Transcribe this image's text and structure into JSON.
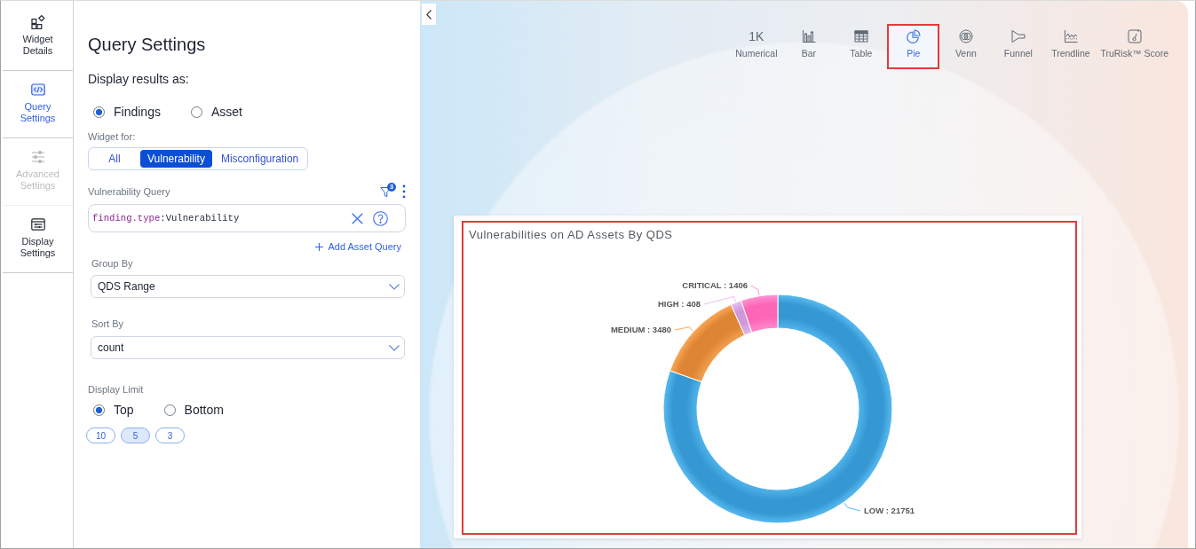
{
  "sidebar": {
    "items": [
      {
        "label": "Widget Details",
        "selected": false,
        "disabled": false
      },
      {
        "label": "Query Settings",
        "selected": true,
        "disabled": false
      },
      {
        "label": "Advanced Settings",
        "selected": false,
        "disabled": true
      },
      {
        "label": "Display Settings",
        "selected": false,
        "disabled": false
      }
    ]
  },
  "query_settings": {
    "title": "Query Settings",
    "display_results": {
      "label": "Display results as:",
      "options": [
        {
          "label": "Findings",
          "selected": true
        },
        {
          "label": "Asset",
          "selected": false
        }
      ]
    },
    "widget_for": {
      "label": "Widget for:",
      "tabs": [
        {
          "label": "All",
          "selected": false
        },
        {
          "label": "Vulnerability",
          "selected": true
        },
        {
          "label": "Misconfiguration",
          "selected": false
        }
      ]
    },
    "query": {
      "label": "Vulnerability Query",
      "filter_badge": "3",
      "tokens": [
        {
          "kind": "key",
          "text": "finding.type"
        },
        {
          "kind": "operator",
          "text": ":"
        },
        {
          "kind": "value",
          "text": "Vulnerability"
        }
      ],
      "add_link": "Add Asset Query"
    },
    "group_by": {
      "label": "Group By",
      "value": "QDS Range"
    },
    "sort_by": {
      "label": "Sort By",
      "value": "count"
    },
    "display_limit": {
      "label": "Display Limit",
      "options": [
        {
          "label": "Top",
          "selected": true
        },
        {
          "label": "Bottom",
          "selected": false
        }
      ],
      "chips": [
        {
          "label": "10",
          "selected": false
        },
        {
          "label": "5",
          "selected": true
        },
        {
          "label": "3",
          "selected": false
        }
      ]
    }
  },
  "preview": {
    "chart_types": [
      {
        "label": "Numerical",
        "glyph": "1K",
        "selected": false,
        "highlighted": false
      },
      {
        "label": "Bar",
        "selected": false,
        "highlighted": false
      },
      {
        "label": "Table",
        "selected": false,
        "highlighted": false
      },
      {
        "label": "Pie",
        "selected": true,
        "highlighted": true
      },
      {
        "label": "Venn",
        "selected": false,
        "highlighted": false
      },
      {
        "label": "Funnel",
        "selected": false,
        "highlighted": false
      },
      {
        "label": "Trendline",
        "selected": false,
        "highlighted": false
      },
      {
        "label": "TruRisk™ Score",
        "selected": false,
        "highlighted": false
      }
    ],
    "widget": {
      "highlighted": true,
      "chart_data": {
        "type": "donut",
        "title": "Vulnerabilities on AD Assets By QDS",
        "values": [
          21751,
          3480,
          408,
          1406
        ],
        "value_labels": [
          "LOW : 21751",
          "MEDIUM : 3480",
          "HIGH : 408",
          "CRITICAL : 1406"
        ]
      }
    }
  }
}
